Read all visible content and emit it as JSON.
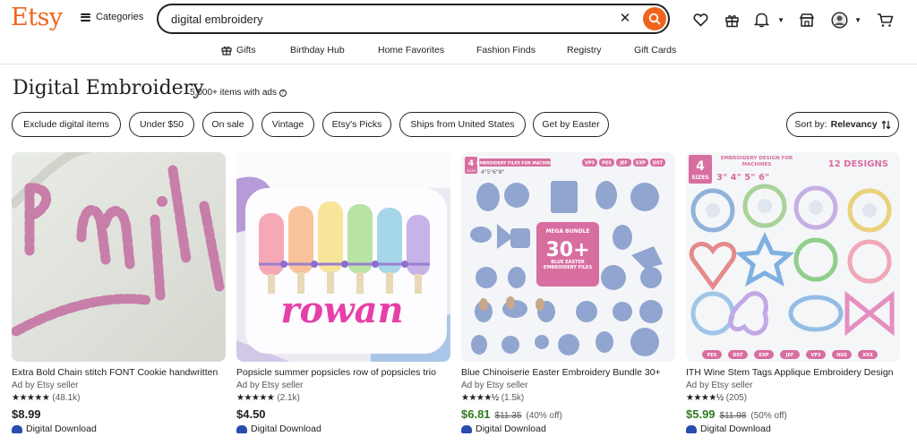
{
  "header": {
    "logo": "Etsy",
    "categories_label": "Categories",
    "search_value": "digital embroidery",
    "accent": "#f1641e"
  },
  "subnav": {
    "items": [
      {
        "label": "Gifts",
        "icon": "gift-icon"
      },
      {
        "label": "Birthday Hub"
      },
      {
        "label": "Home Favorites"
      },
      {
        "label": "Fashion Finds"
      },
      {
        "label": "Registry"
      },
      {
        "label": "Gift Cards"
      }
    ]
  },
  "page": {
    "title": "Digital Embroidery",
    "result_count": "5,000+ items with ads"
  },
  "filters": [
    "Exclude digital items",
    "Under $50",
    "On sale",
    "Vintage",
    "Etsy's Picks",
    "Ships from United States",
    "Get by Easter"
  ],
  "sort": {
    "prefix": "Sort by:",
    "value": "Relevancy"
  },
  "products": [
    {
      "name": "Extra Bold Chain stitch FONT Cookie handwritten",
      "ad": "Ad by Etsy seller",
      "stars": "★★★★★",
      "reviews": "(48.1k)",
      "price": "$8.99",
      "original_price": "",
      "discount": "",
      "download": "Digital Download"
    },
    {
      "name": "Popsicle summer popsicles row of popsicles trio",
      "ad": "Ad by Etsy seller",
      "stars": "★★★★★",
      "reviews": "(2.1k)",
      "price": "$4.50",
      "original_price": "",
      "discount": "",
      "download": "Digital Download",
      "image_text": "rowan"
    },
    {
      "name": "Blue Chinoiserie Easter Embroidery Bundle 30+",
      "ad": "Ad by Etsy seller",
      "stars": "★★★★½",
      "reviews": "(1.5k)",
      "price": "$6.81",
      "original_price": "$11.35",
      "discount": "(40% off)",
      "download": "Digital Download",
      "image_text": {
        "sizes_num": "4",
        "sizes": "SIZES",
        "header": "EMBROIDERY FILES FOR MACHINE",
        "size_list": "4\"5\"6\"8\"",
        "formats": [
          "VP3",
          "PES",
          "JEF",
          "EXP",
          "DST"
        ],
        "badge_title": "MEGA BUNDLE",
        "badge_num": "30+",
        "badge_sub": "BLUE EASTER EMBROIDERY FILES"
      }
    },
    {
      "name": "ITH Wine Stem Tags Applique Embroidery Design",
      "ad": "Ad by Etsy seller",
      "stars": "★★★★½",
      "reviews": "(205)",
      "price": "$5.99",
      "original_price": "$11.98",
      "discount": "(50% off)",
      "download": "Digital Download",
      "image_text": {
        "sizes_num": "4",
        "sizes": "SIZES",
        "header": "EMBROIDERY DESIGN FOR MACHINES",
        "size_list": "3\" 4\" 5\" 6\"",
        "designs": "12 DESIGNS",
        "formats": [
          "PES",
          "DST",
          "EXP",
          "JEF",
          "VP3",
          "HUS",
          "XXX"
        ]
      }
    }
  ]
}
